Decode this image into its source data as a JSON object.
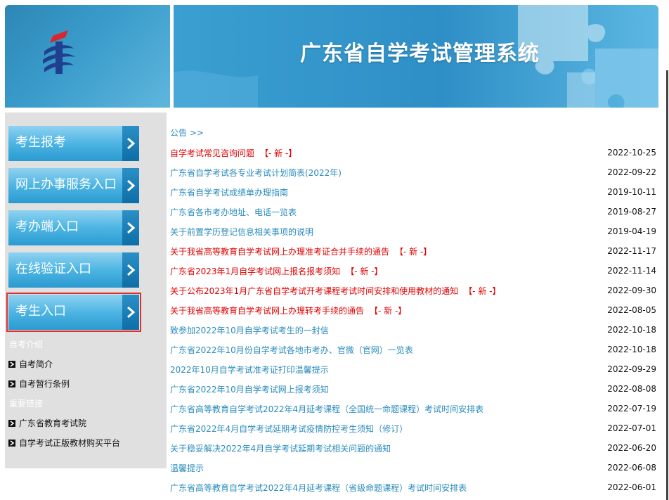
{
  "header": {
    "title": "广东省自学考试管理系统"
  },
  "sidebar": {
    "buttons": [
      {
        "label": "考生报考"
      },
      {
        "label": "网上办事服务入口"
      },
      {
        "label": "考办端入口"
      },
      {
        "label": "在线验证入口"
      },
      {
        "label": "考生入口"
      }
    ],
    "sections": [
      {
        "title": "自考介绍",
        "links": [
          "自考简介",
          "自考暂行条例"
        ]
      },
      {
        "title": "重要链接",
        "links": [
          "广东省教育考试院",
          "自学考试正版教材购买平台"
        ]
      }
    ]
  },
  "notices": {
    "heading": "公告 >>",
    "new_tag": "【- 新 -】",
    "items": [
      {
        "title": "自学考试常见咨询问题",
        "date": "2022-10-25",
        "is_new": true
      },
      {
        "title": "广东省自学考试各专业考试计划简表(2022年)",
        "date": "2022-09-22",
        "is_new": false
      },
      {
        "title": "广东省自学考试成绩单办理指南",
        "date": "2019-10-11",
        "is_new": false
      },
      {
        "title": "广东省各市考办地址、电话一览表",
        "date": "2019-08-27",
        "is_new": false
      },
      {
        "title": "关于前置学历登记信息相关事项的说明",
        "date": "2019-04-19",
        "is_new": false
      },
      {
        "title": "关于我省高等教育自学考试网上办理准考证合并手续的通告",
        "date": "2022-11-17",
        "is_new": true
      },
      {
        "title": "广东省2023年1月自学考试网上报名报考须知",
        "date": "2022-11-14",
        "is_new": true
      },
      {
        "title": "关于公布2023年1月广东省自学考试开考课程考试时间安排和使用教材的通知",
        "date": "2022-09-30",
        "is_new": true
      },
      {
        "title": "关于我省高等教育自学考试网上办理转考手续的通告",
        "date": "2022-08-05",
        "is_new": true
      },
      {
        "title": "致参加2022年10月自学考试考生的一封信",
        "date": "2022-10-18",
        "is_new": false
      },
      {
        "title": "广东省2022年10月份自学考试各地市考办、官微（官网）一览表",
        "date": "2022-10-18",
        "is_new": false
      },
      {
        "title": "2022年10月自学考试准考证打印温馨提示",
        "date": "2022-09-29",
        "is_new": false
      },
      {
        "title": "广东省2022年10月自学考试网上报考须知",
        "date": "2022-08-08",
        "is_new": false
      },
      {
        "title": "广东省高等教育自学考试2022年4月延考课程（全国统一命题课程）考试时间安排表",
        "date": "2022-07-19",
        "is_new": false
      },
      {
        "title": "广东省2022年4月自学考试延期考试疫情防控考生须知（修订）",
        "date": "2022-07-01",
        "is_new": false
      },
      {
        "title": "关于稳妥解决2022年4月自学考试延期考试相关问题的通知",
        "date": "2022-06-20",
        "is_new": false
      },
      {
        "title": "温馨提示",
        "date": "2022-06-08",
        "is_new": false
      },
      {
        "title": "广东省高等教育自学考试2022年4月延考课程（省级命题课程）考试时间安排表",
        "date": "2022-06-01",
        "is_new": false
      }
    ]
  },
  "colors": {
    "accent_blue": "#2a8bbd",
    "new_red": "#e10000",
    "active_outline": "#e12f2f"
  }
}
